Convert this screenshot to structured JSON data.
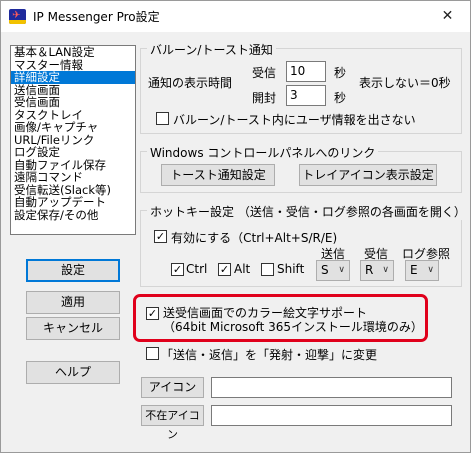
{
  "window": {
    "title": "IP Messenger Pro設定",
    "close_glyph": "✕"
  },
  "categories": [
    {
      "label": "基本＆LAN設定"
    },
    {
      "label": "マスター情報"
    },
    {
      "label": "詳細設定"
    },
    {
      "label": "送信画面"
    },
    {
      "label": "受信画面"
    },
    {
      "label": "タスクトレイ"
    },
    {
      "label": "画像/キャプチャ"
    },
    {
      "label": "URL/Fileリンク"
    },
    {
      "label": "ログ設定"
    },
    {
      "label": "自動ファイル保存"
    },
    {
      "label": "遠隔コマンド"
    },
    {
      "label": "受信転送(Slack等)"
    },
    {
      "label": "自動アップデート"
    },
    {
      "label": "設定保存/その他"
    }
  ],
  "selected_category_index": 2,
  "buttons": {
    "settings": "設定",
    "apply": "適用",
    "cancel": "キャンセル",
    "help": "ヘルプ"
  },
  "balloon": {
    "legend": "バルーン/トースト通知",
    "display_time_label": "通知の表示時間",
    "receive_label": "受信",
    "receive_value": "10",
    "open_label": "開封",
    "open_value": "3",
    "unit": "秒",
    "hint": "表示しない＝0秒",
    "hide_user_info_label": "バルーン/トースト内にユーザ情報を出さない",
    "hide_user_info_checked": false
  },
  "control_panel": {
    "legend": "Windows コントロールパネルへのリンク",
    "toast_button": "トースト通知設定",
    "tray_button": "トレイアイコン表示設定"
  },
  "hotkey": {
    "legend": "ホットキー設定 （送信・受信・ログ参照の各画面を開く）",
    "enable_label": "有効にする（Ctrl+Alt+S/R/E)",
    "enable_checked": true,
    "ctrl_label": "Ctrl",
    "ctrl_checked": true,
    "alt_label": "Alt",
    "alt_checked": true,
    "shift_label": "Shift",
    "shift_checked": false,
    "send_header": "送信",
    "receive_header": "受信",
    "log_header": "ログ参照",
    "send_key": "S",
    "receive_key": "R",
    "log_key": "E"
  },
  "emoji": {
    "label_line1": "送受信画面でのカラー絵文字サポート",
    "label_line2": "（64bit Microsoft 365インストール環境のみ）",
    "checked": true
  },
  "rename": {
    "label": "「送信・返信」を「発射・迎撃」に変更",
    "checked": false
  },
  "icon_field": {
    "button": "アイコン",
    "value": ""
  },
  "absent_icon_field": {
    "button": "不在アイコン",
    "value": ""
  },
  "colors": {
    "selection": "#0078d7",
    "highlight": "#e0001b"
  }
}
